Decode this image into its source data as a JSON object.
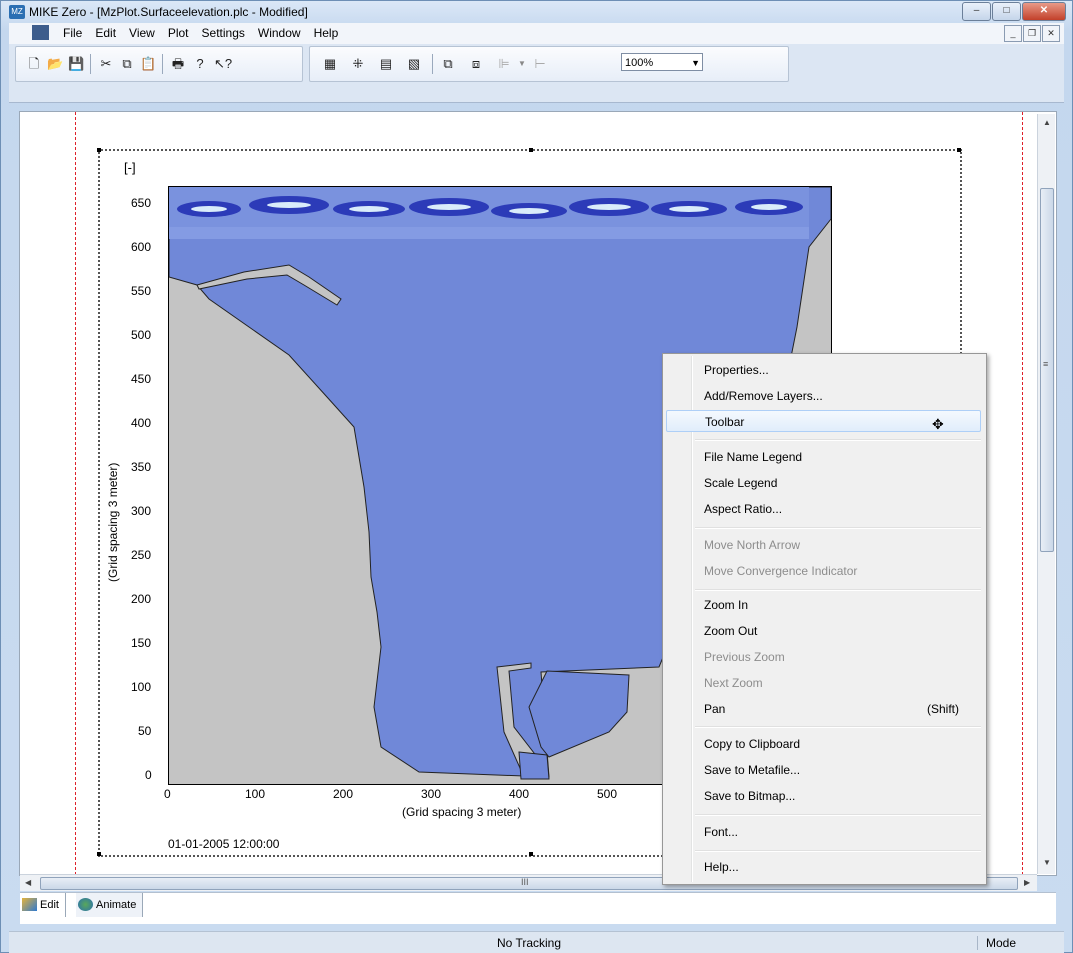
{
  "window": {
    "title": "MIKE Zero - [MzPlot.Surfaceelevation.plc - Modified]",
    "min_glyph": "–",
    "max_glyph": "□",
    "close_glyph": "✕"
  },
  "menubar": {
    "items": [
      "File",
      "Edit",
      "View",
      "Plot",
      "Settings",
      "Window",
      "Help"
    ],
    "mdi_buttons": [
      "_",
      "❐",
      "✕"
    ]
  },
  "toolbar": {
    "icons": [
      "new-file-icon",
      "open-folder-icon",
      "save-icon",
      "cut-icon",
      "copy-icon",
      "paste-icon",
      "print-icon",
      "help-icon",
      "context-help-icon",
      "grid-icon",
      "spread-icon",
      "select-icon",
      "zoom-layer-icon",
      "bring-front-icon",
      "send-back-icon",
      "align-icon",
      "dropdown-icon",
      "distribute-icon"
    ],
    "zoom_value": "100%"
  },
  "plot": {
    "unit_label": "[-]",
    "y_axis_label": "(Grid spacing 3 meter)",
    "x_axis_label": "(Grid spacing 3 meter)",
    "timestamp": "01-01-2005 12:00:00",
    "y_ticks": [
      "650",
      "600",
      "550",
      "500",
      "450",
      "400",
      "350",
      "300",
      "250",
      "200",
      "150",
      "100",
      "50",
      "0"
    ],
    "x_ticks": [
      "0",
      "100",
      "200",
      "300",
      "400",
      "500"
    ],
    "colors": {
      "water": "#7088d8",
      "land": "#c4c4c4",
      "wave_dark": "#2c3bb8",
      "wave_light": "#d9ecfa"
    }
  },
  "scroll": {
    "h_glyph": "III",
    "v_glyph": "≡"
  },
  "tabs": [
    {
      "label": "Edit",
      "icon": "edit-plot-icon"
    },
    {
      "label": "Animate",
      "icon": "animate-icon"
    }
  ],
  "status": {
    "center": "No Tracking",
    "mode": "Mode"
  },
  "context_menu": {
    "items": [
      {
        "label": "Properties...",
        "enabled": true
      },
      {
        "label": "Add/Remove Layers...",
        "enabled": true
      },
      {
        "label": "Toolbar",
        "enabled": true,
        "highlighted": true
      },
      {
        "separator": true
      },
      {
        "label": "File Name Legend",
        "enabled": true
      },
      {
        "label": "Scale Legend",
        "enabled": true
      },
      {
        "label": "Aspect Ratio...",
        "enabled": true
      },
      {
        "separator": true
      },
      {
        "label": "Move North Arrow",
        "enabled": false
      },
      {
        "label": "Move Convergence Indicator",
        "enabled": false
      },
      {
        "separator": true
      },
      {
        "label": "Zoom In",
        "enabled": true
      },
      {
        "label": "Zoom Out",
        "enabled": true
      },
      {
        "label": "Previous Zoom",
        "enabled": false
      },
      {
        "label": "Next Zoom",
        "enabled": false
      },
      {
        "label": "Pan",
        "enabled": true,
        "shortcut": "(Shift)"
      },
      {
        "separator": true
      },
      {
        "label": "Copy to Clipboard",
        "enabled": true
      },
      {
        "label": "Save to Metafile...",
        "enabled": true
      },
      {
        "label": "Save to Bitmap...",
        "enabled": true
      },
      {
        "separator": true
      },
      {
        "label": "Font...",
        "enabled": true
      },
      {
        "separator": true
      },
      {
        "label": "Help...",
        "enabled": true
      }
    ],
    "cursor": "move-cursor-icon"
  }
}
